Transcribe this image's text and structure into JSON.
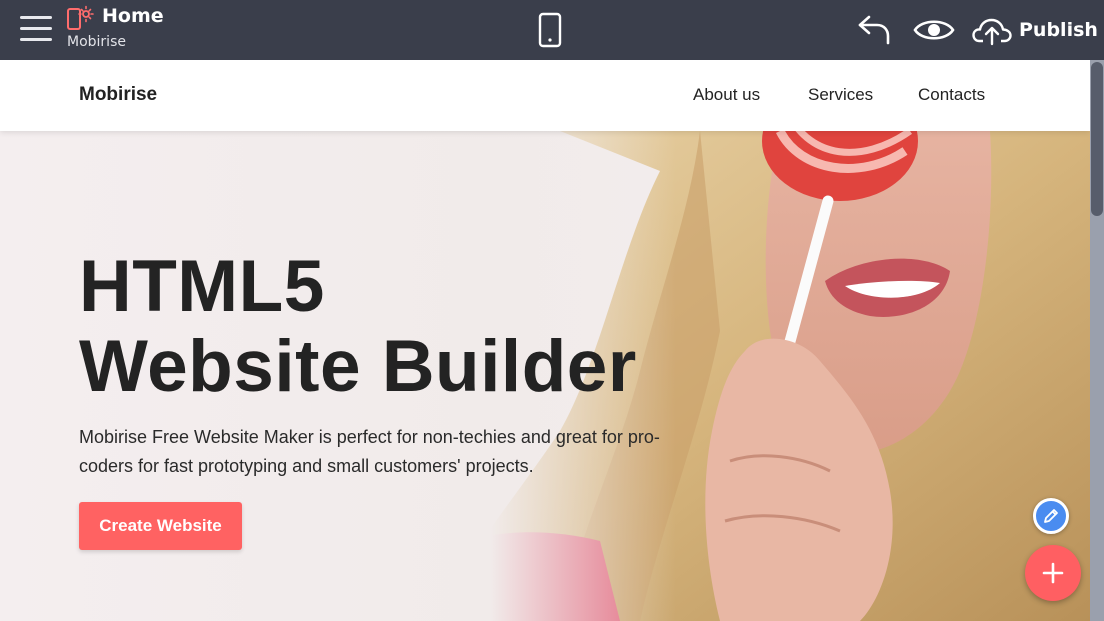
{
  "editor": {
    "page_title": "Home",
    "site_name": "Mobirise",
    "publish_label": "Publish",
    "icons": [
      "menu-icon",
      "page-icon",
      "mobile-device-icon",
      "undo-icon",
      "preview-eye-icon",
      "cloud-upload-icon"
    ]
  },
  "site": {
    "brand": "Mobirise",
    "nav": {
      "about": "About us",
      "services": "Services",
      "contacts": "Contacts"
    },
    "hero": {
      "title_line1": "HTML5",
      "title_line2": "Website Builder",
      "text": "Mobirise Free Website Maker is perfect for non-techies and great for pro-coders for fast prototyping and small customers' projects.",
      "cta_label": "Create Website"
    }
  },
  "colors": {
    "topbar": "#3a3e4b",
    "accent": "#ff6262",
    "edit_fab": "#4a8cf0"
  }
}
